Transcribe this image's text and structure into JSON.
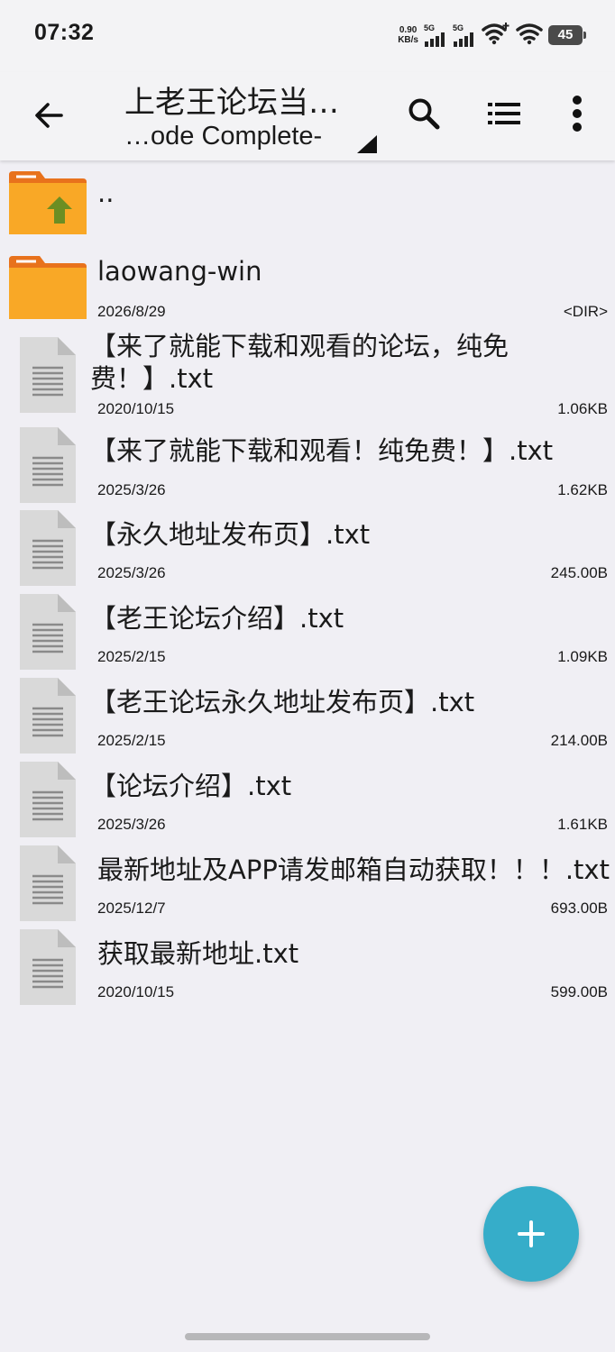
{
  "status_bar": {
    "time": "07:32",
    "net_speed_value": "0.90",
    "net_speed_unit": "KB/s",
    "signal1_label": "5G",
    "signal2_label": "5G",
    "battery": "45"
  },
  "toolbar": {
    "title": "上老王论坛当…",
    "subtitle": "…ode Complete-",
    "icons": [
      "back-arrow-icon",
      "search-icon",
      "list-view-icon",
      "more-vert-icon"
    ]
  },
  "files": [
    {
      "name": "..",
      "type": "parent",
      "date": "",
      "size": ""
    },
    {
      "name": "laowang-win",
      "type": "folder",
      "date": "2026/8/29",
      "size": "<DIR>"
    },
    {
      "name": "【来了就能下载和观看的论坛，纯免费！】.txt",
      "type": "file",
      "date": "2020/10/15",
      "size": "1.06KB"
    },
    {
      "name": "【来了就能下载和观看！纯免费！】.txt",
      "type": "file",
      "date": "2025/3/26",
      "size": "1.62KB"
    },
    {
      "name": "【永久地址发布页】.txt",
      "type": "file",
      "date": "2025/3/26",
      "size": "245.00B"
    },
    {
      "name": "【老王论坛介绍】.txt",
      "type": "file",
      "date": "2025/2/15",
      "size": "1.09KB"
    },
    {
      "name": "【老王论坛永久地址发布页】.txt",
      "type": "file",
      "date": "2025/2/15",
      "size": "214.00B"
    },
    {
      "name": "【论坛介绍】.txt",
      "type": "file",
      "date": "2025/3/26",
      "size": "1.61KB"
    },
    {
      "name": "最新地址及APP请发邮箱自动获取！！！.txt",
      "type": "file",
      "date": "2025/12/7",
      "size": "693.00B"
    },
    {
      "name": "获取最新地址.txt",
      "type": "file",
      "date": "2020/10/15",
      "size": "599.00B"
    }
  ],
  "colors": {
    "folder": "#f9a826",
    "folder_tab": "#e8721c",
    "up_arrow": "#6b8e23",
    "fab": "#36adc9",
    "file_icon": "#d9d9d9"
  }
}
